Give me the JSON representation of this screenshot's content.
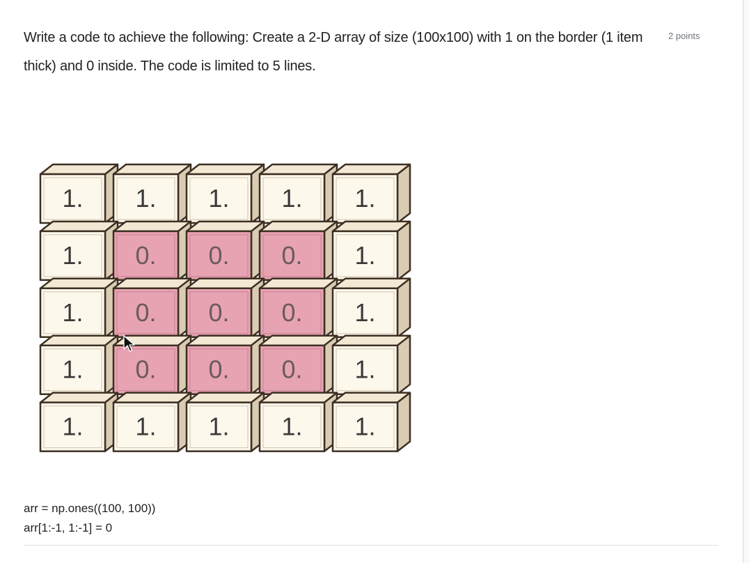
{
  "question": {
    "text": "Write a code to achieve the following: Create a 2-D array of size (100x100) with 1 on the border (1 item thick) and 0 inside. The code is limited to 5 lines.",
    "points": "2 points"
  },
  "figure": {
    "grid": [
      [
        "1.",
        "1.",
        "1.",
        "1.",
        "1."
      ],
      [
        "1.",
        "0.",
        "0.",
        "0.",
        "1."
      ],
      [
        "1.",
        "0.",
        "0.",
        "0.",
        "1."
      ],
      [
        "1.",
        "0.",
        "0.",
        "0.",
        "1."
      ],
      [
        "1.",
        "1.",
        "1.",
        "1.",
        "1."
      ]
    ],
    "colors": {
      "one_face": "#fdf8ec",
      "zero_face": "#e7a3b2",
      "top_face": "#f2e8d3",
      "side_face": "#d9ccb3",
      "outline": "#3d2f22"
    }
  },
  "answer": {
    "line1": "arr = np.ones((100, 100))",
    "line2": "arr[1:-1, 1:-1] = 0"
  },
  "cursor": {
    "icon": "mouse-pointer-icon"
  }
}
